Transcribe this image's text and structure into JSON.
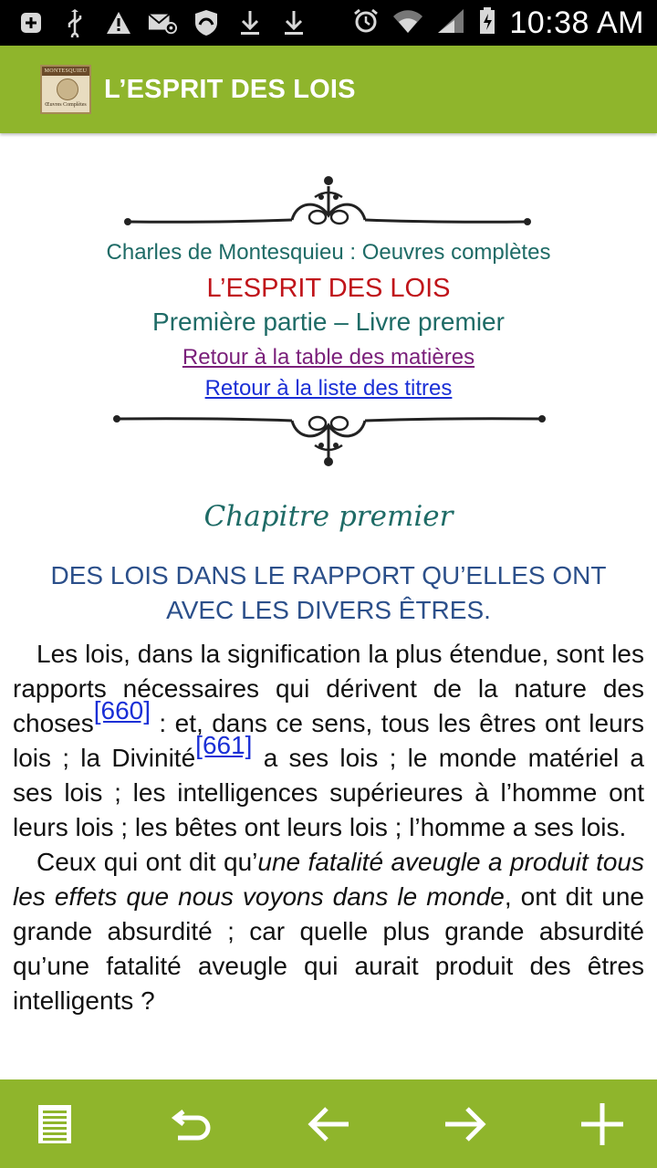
{
  "status_bar": {
    "time": "10:38 AM",
    "icons": [
      "add-icon",
      "usb-icon",
      "warning-icon",
      "email-icon",
      "shield-icon",
      "download-icon",
      "download-icon",
      "alarm-icon",
      "wifi-icon",
      "signal-icon",
      "battery-icon"
    ]
  },
  "app_bar": {
    "title": "L’ESPRIT DES LOIS",
    "logo_band": "MONTESQUIEU",
    "logo_sub": "Œuvres Complètes",
    "color": "#8fb52c"
  },
  "header": {
    "author": "Charles de Montesquieu : Oeuvres complètes",
    "book_title": "L’ESPRIT DES LOIS",
    "part": "Première partie – Livre premier",
    "link_toc": "Retour à la table des matières",
    "link_titles": "Retour à la liste des titres"
  },
  "chapter": {
    "title": "Chapitre premier",
    "subtitle": "DES LOIS DANS LE RAPPORT QU’ELLES ONT AVEC LES DIVERS ÊTRES."
  },
  "body": {
    "p1_part1": "Les lois, dans la signification la plus étendue, sont les rapports nécessaires qui dérivent de la nature des choses",
    "note1": "[660]",
    "p1_part2": " : et, dans ce sens, tous les êtres ont leurs lois ; la Divinité",
    "note2": "[661]",
    "p1_part3": " a ses lois ; le monde matériel a ses lois ; les intelligences supérieures à l’homme ont leurs lois ; les bêtes ont leurs lois ; l’homme a ses lois.",
    "p2_part1": "Ceux qui ont dit qu’",
    "p2_italic": "une fatalité aveugle a produit tous les effets que nous voyons dans le monde",
    "p2_part2": ", ont dit une grande absurdité ; car quelle plus grande absurdité qu’une fatalité aveugle qui aurait produit des êtres intelligents ?"
  },
  "bottom_bar": {
    "buttons": [
      "toc-icon",
      "return-icon",
      "arrow-left-icon",
      "arrow-right-icon",
      "plus-icon"
    ]
  }
}
